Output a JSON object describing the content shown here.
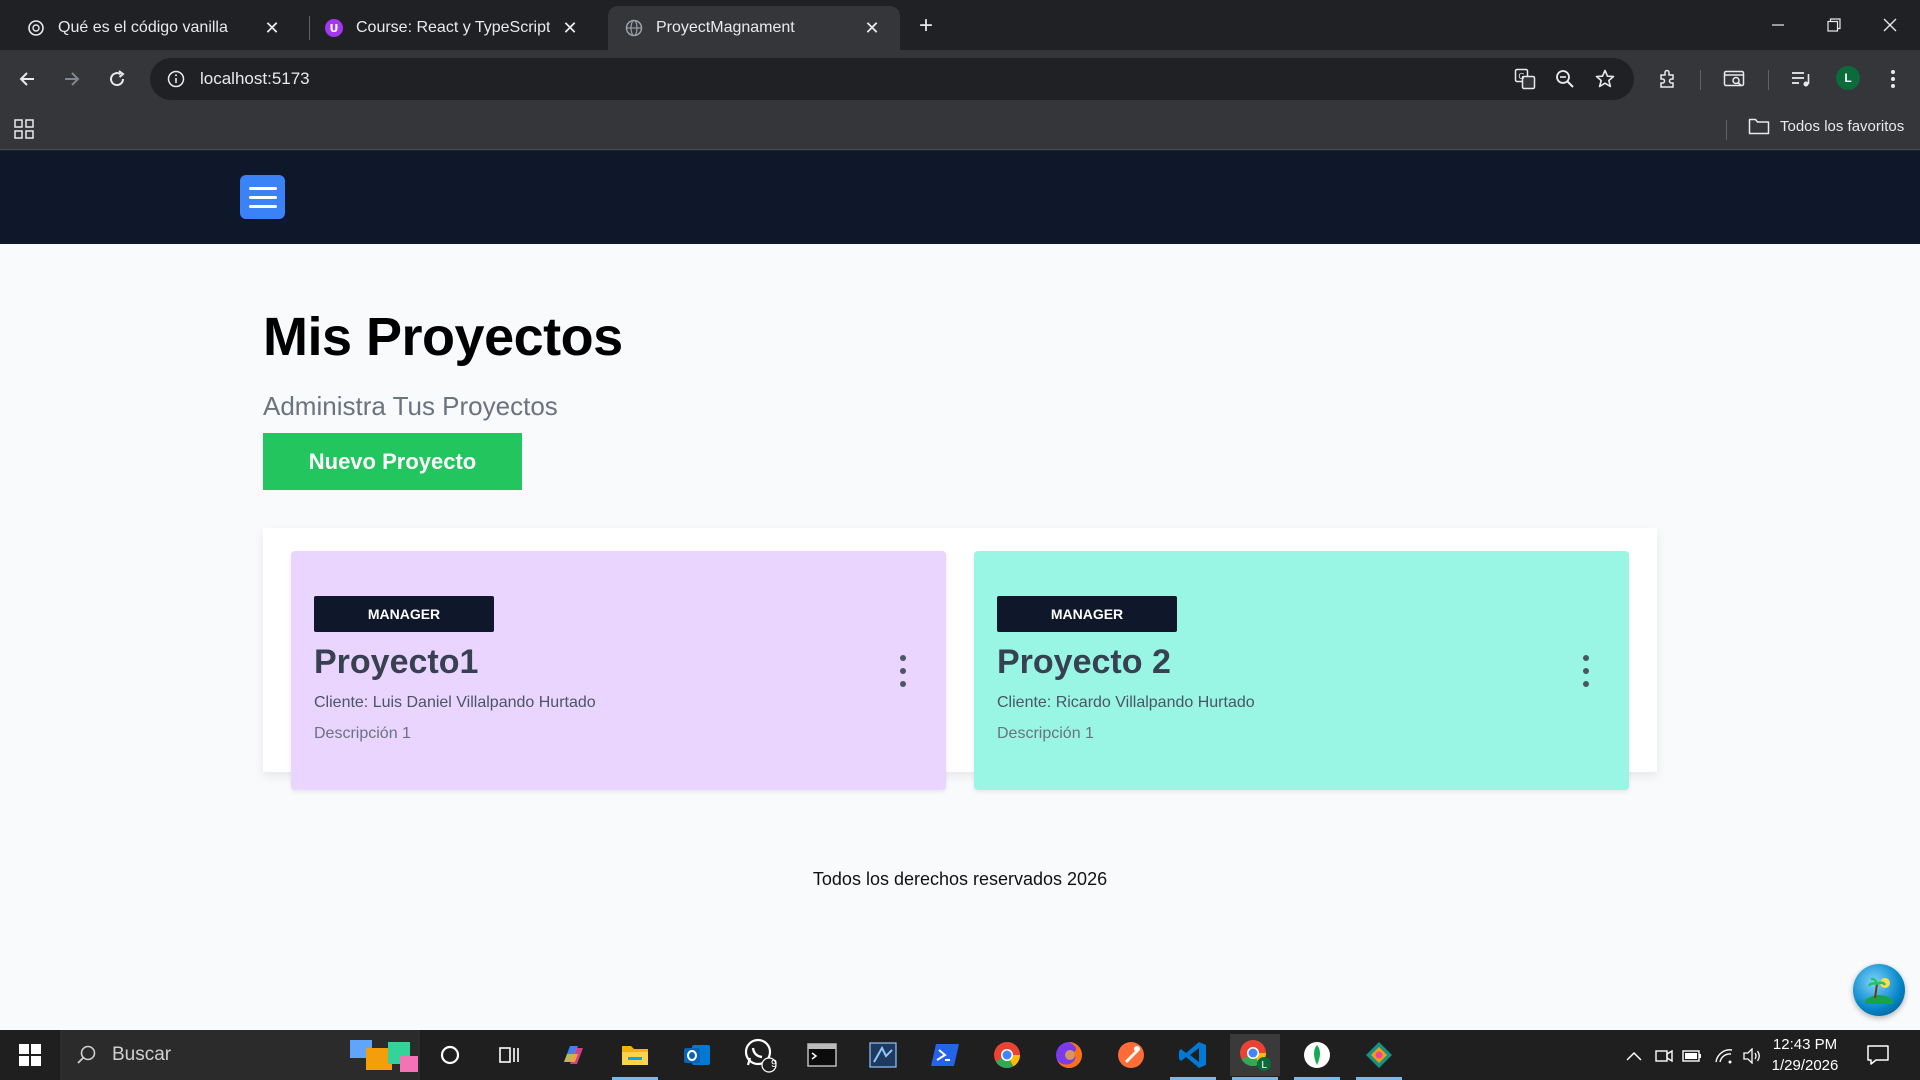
{
  "browser": {
    "tabs": [
      {
        "title": "Qué es el código vanilla",
        "favicon": "openai-icon"
      },
      {
        "title": "Course: React y TypeScript - La",
        "favicon": "udemy-icon"
      },
      {
        "title": "ProyectMagnament",
        "favicon": "globe-icon",
        "active": true
      }
    ],
    "url": "localhost:5173",
    "bookmarks_folder": "Todos los favoritos",
    "profile_initial": "L"
  },
  "page": {
    "title": "Mis Proyectos",
    "subtitle": "Administra Tus Proyectos",
    "new_project_label": "Nuevo Proyecto",
    "projects": [
      {
        "role": "MANAGER",
        "name": "Proyecto1",
        "client": "Cliente: Luis Daniel Villalpando Hurtado",
        "description": "Descripción 1",
        "color": "#e9d5ff"
      },
      {
        "role": "MANAGER",
        "name": "Proyecto 2",
        "client": "Cliente: Ricardo Villalpando Hurtado",
        "description": "Descripción 1",
        "color": "#99f6e4"
      }
    ],
    "footer": "Todos los derechos reservados 2026",
    "colors": {
      "header": "#0f172a",
      "menu_button": "#3b82f6",
      "new_button": "#22c55e"
    }
  },
  "taskbar": {
    "search_placeholder": "Buscar",
    "whatsapp_badge": "9",
    "time": "12:43 PM",
    "date": "1/29/2026"
  }
}
